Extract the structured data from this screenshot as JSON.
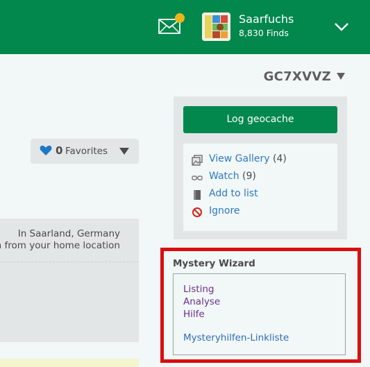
{
  "header": {
    "username": "Saarfuchs",
    "finds": "8,830 Finds",
    "mail_icon": "mail-icon",
    "brand_color": "#02874d",
    "notification_color": "#e8b61c"
  },
  "cache": {
    "code": "GC7XVVZ"
  },
  "favorites": {
    "count": "0",
    "label": "Favorites"
  },
  "location": {
    "line1": "In Saarland, Germany",
    "line2": "n from your home location"
  },
  "sidebar": {
    "log_button": "Log geocache",
    "links": [
      {
        "label": "View Gallery",
        "count": "(4)",
        "icon": "gallery-icon"
      },
      {
        "label": "Watch",
        "count": "(9)",
        "icon": "glasses-icon"
      },
      {
        "label": "Add to list",
        "count": "",
        "icon": "bookmark-icon"
      },
      {
        "label": "Ignore",
        "count": "",
        "icon": "ignore-icon"
      }
    ]
  },
  "mystery_wizard": {
    "title": "Mystery Wizard",
    "links": [
      "Listing",
      "Analyse",
      "Hilfe"
    ],
    "link_list": "Mysteryhilfen-Linkliste",
    "highlight_color": "#d90f0f"
  }
}
